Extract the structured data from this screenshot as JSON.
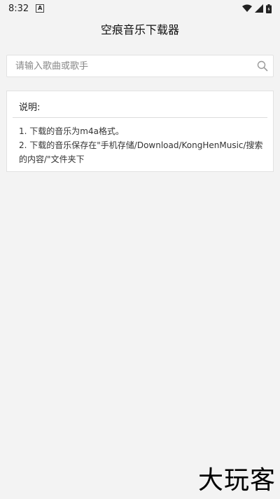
{
  "status_bar": {
    "time": "8:32",
    "app_icon_letter": "A",
    "icons": [
      "wifi-icon",
      "signal-icon",
      "battery-icon"
    ]
  },
  "app_bar": {
    "title": "空痕音乐下载器"
  },
  "search": {
    "placeholder": "请输入歌曲或歌手",
    "value": ""
  },
  "instructions": {
    "title": "说明:",
    "items": [
      "1. 下载的音乐为m4a格式。",
      "2. 下载的音乐保存在\"手机存储/Download/KongHenMusic/搜索的内容/\"文件夹下"
    ]
  },
  "watermark": {
    "text": "大玩客"
  },
  "colors": {
    "background": "#f3f3f3",
    "card": "#ffffff",
    "border": "#e2e2e2"
  }
}
